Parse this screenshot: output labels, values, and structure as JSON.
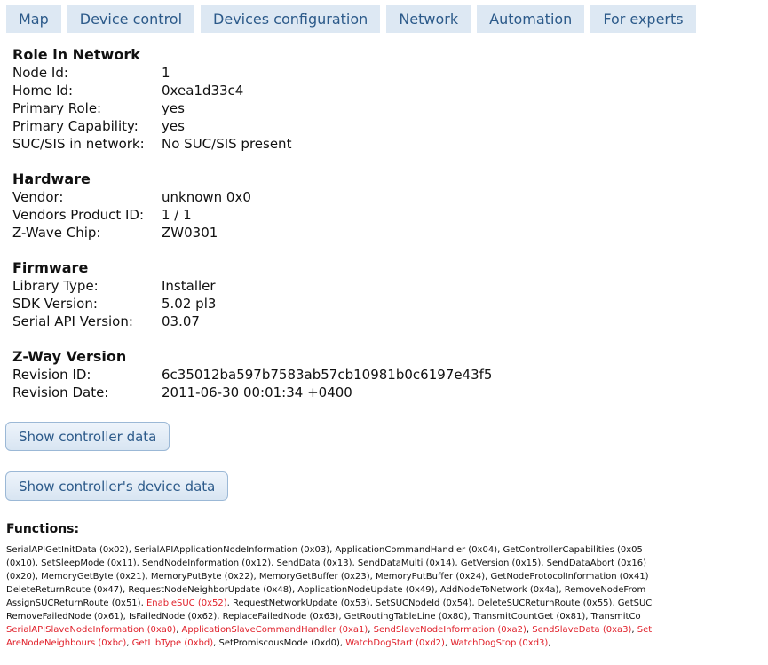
{
  "tabs": [
    "Map",
    "Device control",
    "Devices configuration",
    "Network",
    "Automation",
    "For experts"
  ],
  "sections": [
    {
      "title": "Role in Network",
      "rows": [
        {
          "label": "Node Id:",
          "value": "1"
        },
        {
          "label": "Home Id:",
          "value": "0xea1d33c4"
        },
        {
          "label": "Primary Role:",
          "value": "yes"
        },
        {
          "label": "Primary Capability:",
          "value": "yes"
        },
        {
          "label": "SUC/SIS in network:",
          "value": "No SUC/SIS present"
        }
      ]
    },
    {
      "title": "Hardware",
      "rows": [
        {
          "label": "Vendor:",
          "value": "unknown 0x0"
        },
        {
          "label": "Vendors Product ID:",
          "value": "1 / 1"
        },
        {
          "label": "Z-Wave Chip:",
          "value": "ZW0301"
        }
      ]
    },
    {
      "title": "Firmware",
      "rows": [
        {
          "label": "Library Type:",
          "value": "Installer"
        },
        {
          "label": "SDK Version:",
          "value": "5.02 pl3"
        },
        {
          "label": "Serial API Version:",
          "value": "03.07"
        }
      ]
    },
    {
      "title": "Z-Way Version",
      "rows": [
        {
          "label": "Revision ID:",
          "value": "6c35012ba597b7583ab57cb10981b0c6197e43f5"
        },
        {
          "label": "Revision Date:",
          "value": "2011-06-30 00:01:34 +0400"
        }
      ]
    }
  ],
  "buttons": {
    "show_controller_data": "Show controller data",
    "show_device_data": "Show controller's device data"
  },
  "functions": {
    "title": "Functions:",
    "colors": {
      "supported": "#111111",
      "unsupported": "#e0202a"
    },
    "lines": [
      [
        {
          "t": "SerialAPIGetInitData (0x02), SerialAPIApplicationNodeInformation (0x03), ApplicationCommandHandler (0x04), GetControllerCapabilities (0x05",
          "red": false
        }
      ],
      [
        {
          "t": "(0x10), SetSleepMode (0x11), SendNodeInformation (0x12), SendData (0x13), SendDataMulti (0x14), GetVersion (0x15), SendDataAbort (0x16)",
          "red": false
        }
      ],
      [
        {
          "t": "(0x20), MemoryGetByte (0x21), MemoryPutByte (0x22), MemoryGetBuffer (0x23), MemoryPutBuffer (0x24), GetNodeProtocolInformation (0x41)",
          "red": false
        }
      ],
      [
        {
          "t": "DeleteReturnRoute (0x47), RequestNodeNeighborUpdate (0x48), ApplicationNodeUpdate (0x49), AddNodeToNetwork (0x4a), RemoveNodeFrom",
          "red": false
        }
      ],
      [
        {
          "t": "AssignSUCReturnRoute (0x51), ",
          "red": false
        },
        {
          "t": "EnableSUC (0x52)",
          "red": true
        },
        {
          "t": ", RequestNetworkUpdate (0x53), SetSUCNodeId (0x54), DeleteSUCReturnRoute (0x55), GetSUC",
          "red": false
        }
      ],
      [
        {
          "t": "RemoveFailedNode (0x61), IsFailedNode (0x62), ReplaceFailedNode (0x63), GetRoutingTableLine (0x80), TransmitCountGet (0x81), TransmitCo",
          "red": false
        }
      ],
      [
        {
          "t": "SerialAPISlaveNodeInformation (0xa0)",
          "red": true
        },
        {
          "t": ", ",
          "red": false
        },
        {
          "t": "ApplicationSlaveCommandHandler (0xa1)",
          "red": true
        },
        {
          "t": ", ",
          "red": false
        },
        {
          "t": "SendSlaveNodeInformation (0xa2)",
          "red": true
        },
        {
          "t": ", ",
          "red": false
        },
        {
          "t": "SendSlaveData (0xa3)",
          "red": true
        },
        {
          "t": ", ",
          "red": false
        },
        {
          "t": "Set",
          "red": true
        }
      ],
      [
        {
          "t": "AreNodeNeighbours (0xbc)",
          "red": true
        },
        {
          "t": ", ",
          "red": false
        },
        {
          "t": "GetLibType (0xbd)",
          "red": true
        },
        {
          "t": ", SetPromiscousMode (0xd0), ",
          "red": false
        },
        {
          "t": "WatchDogStart (0xd2)",
          "red": true
        },
        {
          "t": ", ",
          "red": false
        },
        {
          "t": "WatchDogStop (0xd3)",
          "red": true
        },
        {
          "t": ",",
          "red": false
        }
      ]
    ]
  }
}
